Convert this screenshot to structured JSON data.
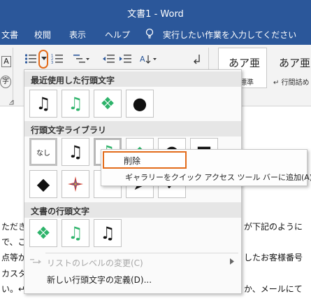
{
  "window": {
    "title": "文書1 - Word"
  },
  "tabs": [
    {
      "label": "文書"
    },
    {
      "label": "校閲"
    },
    {
      "label": "表示"
    },
    {
      "label": "ヘルプ"
    }
  ],
  "tell_me": {
    "label": "実行したい作業を入力してください",
    "icon": "lightbulb-icon"
  },
  "ribbon": {
    "styles": [
      {
        "preview": "あア亜",
        "label": "標準"
      },
      {
        "preview": "あア亜",
        "label": "↵ 行間詰め"
      }
    ],
    "left_letters": [
      "A",
      "字"
    ],
    "icons": [
      "bullets-icon",
      "dropdown-arrow-icon",
      "numbering-icon",
      "multilevel-list-icon",
      "decrease-indent-icon",
      "increase-indent-icon",
      "sort-icon",
      "show-marks-icon"
    ]
  },
  "dropdown": {
    "recent_header": "最近使用した行頭文字",
    "recent": [
      {
        "symbol": "♫",
        "color": "#111111"
      },
      {
        "symbol": "♫",
        "color": "#2db36a"
      },
      {
        "symbol": "❖",
        "color": "#2db36a"
      },
      {
        "symbol": "●",
        "color": "#111111"
      }
    ],
    "library_header": "行頭文字ライブラリ",
    "library_row1": [
      {
        "symbol": "なし",
        "color": "#111111"
      },
      {
        "symbol": "♫",
        "color": "#111111"
      },
      {
        "symbol": "♫",
        "color": "#2db36a"
      },
      {
        "symbol": "◆",
        "color": "#2db36a"
      },
      {
        "symbol": "●",
        "color": "#111111"
      },
      {
        "symbol": "■",
        "color": "#111111"
      }
    ],
    "library_row2": [
      {
        "symbol": "◆",
        "color": "#111111"
      },
      {
        "symbol": "✚",
        "color": "#d04030"
      },
      {
        "symbol": "",
        "color": "#111111"
      },
      {
        "symbol": "➤",
        "color": "#111111"
      },
      {
        "symbol": "✓",
        "color": "#111111"
      }
    ],
    "document_header": "文書の行頭文字",
    "document": [
      {
        "symbol": "❖",
        "color": "#2db36a"
      },
      {
        "symbol": "♫",
        "color": "#2db36a"
      },
      {
        "symbol": "♫",
        "color": "#111111"
      }
    ],
    "change_level": "リストのレベルの変更(C)",
    "define_new": "新しい行頭文字の定義(D)..."
  },
  "context_menu": {
    "delete": "削除",
    "add_to_qat": "ギャラリーをクイック アクセス ツール バーに追加(A)"
  },
  "document": {
    "lines_left": [
      "ただき",
      "で、こ",
      "点等が",
      "カスタ",
      "い。↵"
    ],
    "lines_right": [
      "が下記のように",
      "したお客様番号",
      "か、メールにて"
    ]
  },
  "colors": {
    "title_bar": "#2b579a",
    "highlight": "#e36c1b",
    "accent_green": "#2db36a"
  }
}
